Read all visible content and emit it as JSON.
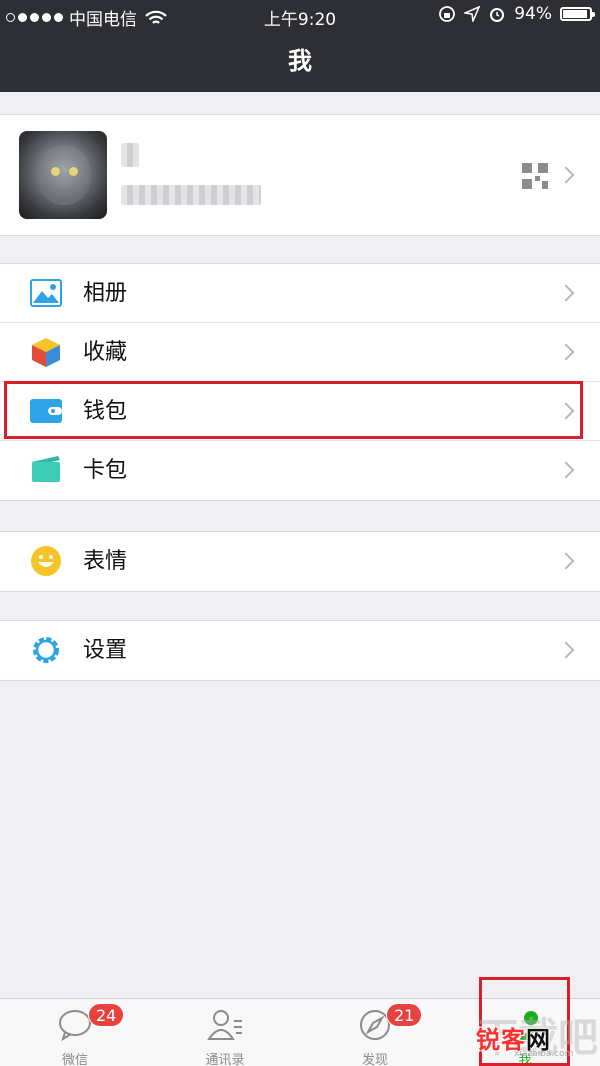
{
  "status_bar": {
    "carrier": "中国电信",
    "time": "上午9:20",
    "battery": "94%",
    "battery_level": 0.94
  },
  "nav": {
    "title": "我"
  },
  "profile": {
    "qr_icon": "qrcode-icon"
  },
  "menu_group1": [
    {
      "label": "相册",
      "icon": "photo-album-icon"
    },
    {
      "label": "收藏",
      "icon": "favorites-cube-icon"
    },
    {
      "label": "钱包",
      "icon": "wallet-icon"
    },
    {
      "label": "卡包",
      "icon": "card-pack-icon"
    }
  ],
  "menu_group2": [
    {
      "label": "表情",
      "icon": "smiley-icon"
    }
  ],
  "menu_group3": [
    {
      "label": "设置",
      "icon": "settings-gear-icon"
    }
  ],
  "tabs": [
    {
      "label": "微信",
      "badge": "24",
      "icon": "chat-bubble-icon"
    },
    {
      "label": "通讯录",
      "badge": "",
      "icon": "contacts-icon"
    },
    {
      "label": "发现",
      "badge": "21",
      "icon": "compass-icon"
    },
    {
      "label": "我",
      "badge": "",
      "icon": "me-icon",
      "active": true
    }
  ],
  "watermark": {
    "text_red": "锐客",
    "text_black": "网",
    "small": "xiazaiba.com",
    "back": "下载吧"
  },
  "colors": {
    "nav_bg": "#2e2f34",
    "background": "#efeff4",
    "highlight": "#d8202b",
    "badge": "#e64340",
    "active_tab": "#1aad19"
  }
}
